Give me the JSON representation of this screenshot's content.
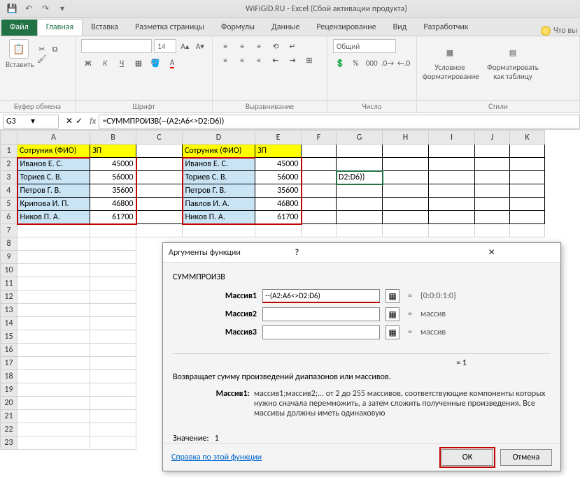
{
  "title": "WiFiGiD.RU - Excel (Сбой активации продукта)",
  "tabs": {
    "file": "Файл",
    "home": "Главная",
    "insert": "Вставка",
    "layout": "Разметка страницы",
    "formulas": "Формулы",
    "data": "Данные",
    "review": "Рецензирование",
    "view": "Вид",
    "developer": "Разработчик",
    "tell": "Что вы"
  },
  "ribbon": {
    "paste": "Вставить",
    "clipboard": "Буфер обмена",
    "font_name": "",
    "font_size": "14",
    "font": "Шрифт",
    "alignment": "Выравнивание",
    "number_format": "Общий",
    "number": "Число",
    "cond_fmt": "Условное форматирование",
    "as_table": "Форматировать как таблицу",
    "styles": "Стили"
  },
  "namebox": "G3",
  "formula": "=СУММПРОИЗВ(--(A2:A6<>D2:D6))",
  "columns": [
    "A",
    "B",
    "C",
    "D",
    "E",
    "F",
    "G",
    "H",
    "I",
    "J",
    "K"
  ],
  "sheet": {
    "header1": "Сотруник (ФИО)",
    "header2": "ЗП",
    "left": [
      {
        "name": "Иванов Е. С.",
        "val": "45000"
      },
      {
        "name": "Ториев С. В.",
        "val": "56000"
      },
      {
        "name": "Петров Г. В.",
        "val": "35600"
      },
      {
        "name": "Крипова И. П.",
        "val": "46800"
      },
      {
        "name": "Ников П. А.",
        "val": "61700"
      }
    ],
    "right": [
      {
        "name": "Иванов Е. С.",
        "val": "45000"
      },
      {
        "name": "Ториев С. В.",
        "val": "56000"
      },
      {
        "name": "Петров Г. В.",
        "val": "35600"
      },
      {
        "name": "Павлов И. А.",
        "val": "46800"
      },
      {
        "name": "Ников П. А.",
        "val": "61700"
      }
    ],
    "g3": "D2:D6))"
  },
  "dialog": {
    "title": "Аргументы функции",
    "func": "СУММПРОИЗВ",
    "arg1_label": "Массив1",
    "arg1_value": "--(A2:A6<>D2:D6)",
    "arg1_result": "{0:0:0:1:0}",
    "arg2_label": "Массив2",
    "arg2_result": "массив",
    "arg3_label": "Массив3",
    "arg3_result": "массив",
    "eq_final": "=   1",
    "desc": "Возвращает сумму произведений диапазонов или массивов.",
    "arghelp_label": "Массив1:",
    "arghelp_text": "массив1;массив2;... от 2 до 255 массивов, соответствующие компоненты которых нужно сначала перемножить, а затем сложить полученные произведения. Все массивы должны иметь одинаковую",
    "value_label": "Значение:",
    "value": "1",
    "help": "Справка по этой функции",
    "ok": "ОК",
    "cancel": "Отмена",
    "help_icon": "?"
  }
}
